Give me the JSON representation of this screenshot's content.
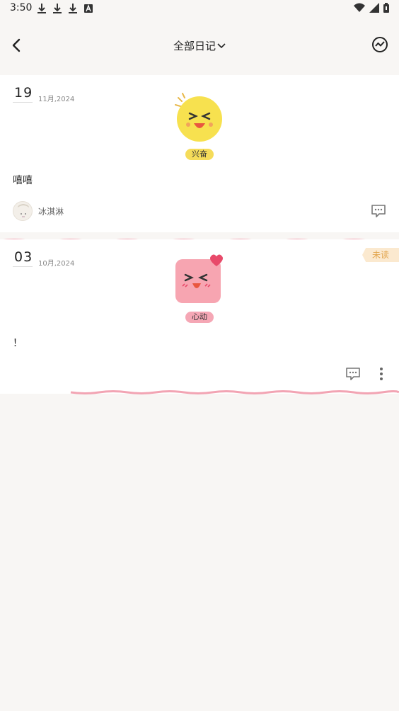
{
  "status": {
    "time": "3:50",
    "left_icons": [
      "download-icon",
      "download-icon",
      "download-icon",
      "a-icon"
    ],
    "right_icons": [
      "wifi-icon",
      "signal-icon",
      "battery-icon"
    ]
  },
  "header": {
    "title": "全部日记",
    "title_icon": "chevron-down-icon",
    "back_icon": "back-icon",
    "stats_icon": "stats-icon"
  },
  "entries": [
    {
      "day": "19",
      "month_year": "11月,2024",
      "mood_label": "兴奋",
      "mood_color": "#f5dc5a",
      "text": "嘻嘻",
      "author": "冰淇淋",
      "unread": ""
    },
    {
      "day": "03",
      "month_year": "10月,2024",
      "mood_label": "心动",
      "mood_color": "#f5a7b5",
      "text": "！",
      "author": "",
      "unread": "未读"
    }
  ],
  "colors": {
    "accent_pink": "#f2a4b3",
    "unread_bg": "#fbe9cf",
    "unread_text": "#e2a44b"
  }
}
